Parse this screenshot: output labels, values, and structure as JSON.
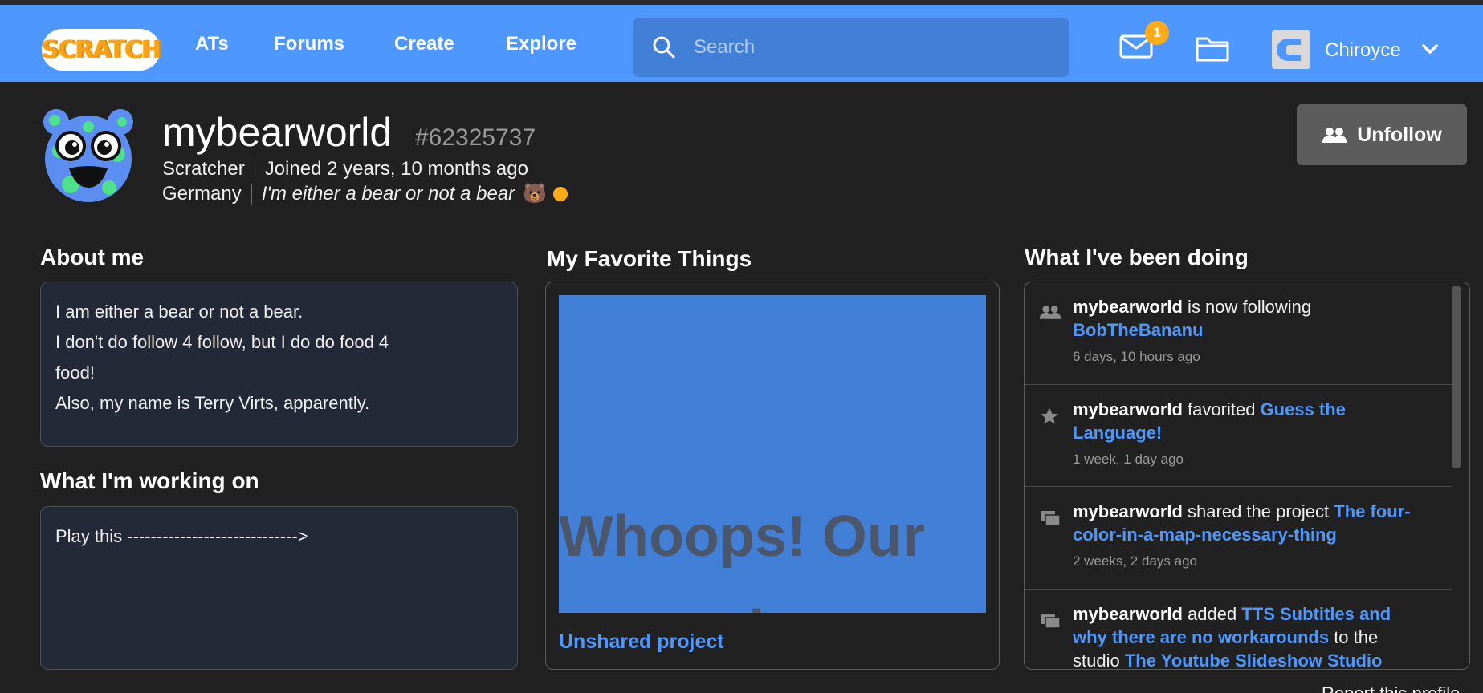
{
  "nav": {
    "logo": "SCRATCH",
    "links": [
      "ATs",
      "Forums",
      "Create",
      "Explore"
    ],
    "search_placeholder": "Search",
    "message_count": "1",
    "username": "Chiroyce"
  },
  "profile": {
    "name": "mybearworld",
    "id": "#62325737",
    "role": "Scratcher",
    "joined": "Joined 2 years, 10 months ago",
    "country": "Germany",
    "status": "I'm either a bear or not a bear",
    "status_emoji": "🐻",
    "unfollow_label": "Unfollow"
  },
  "about": {
    "title": "About me",
    "lines": [
      "I am either a bear or not a bear.",
      "I don't do follow 4 follow, but I do do food 4",
      "food!",
      "Also, my name is Terry Virts, apparently."
    ]
  },
  "working": {
    "title": "What I'm working on",
    "text": "Play this ----------------------------->"
  },
  "favorite": {
    "title": "My Favorite Things",
    "thumb_text": "Whoops! Our server is",
    "project_title": "Unshared project"
  },
  "activity": {
    "title": "What I've been doing",
    "items": [
      {
        "icon": "follow-icon",
        "actor": "mybearworld",
        "verb": " is now following ",
        "link1": "BobTheBananu",
        "mid": "",
        "link2": "",
        "time": "6 days, 10 hours ago"
      },
      {
        "icon": "star-icon",
        "actor": "mybearworld",
        "verb": " favorited ",
        "link1": "Guess the Language!",
        "mid": "",
        "link2": "",
        "time": "1 week, 1 day ago"
      },
      {
        "icon": "share-icon",
        "actor": "mybearworld",
        "verb": " shared the project ",
        "link1": "The four-color-in-a-map-necessary-thing",
        "mid": "",
        "link2": "",
        "time": "2 weeks, 2 days ago"
      },
      {
        "icon": "studio-icon",
        "actor": "mybearworld",
        "verb": " added ",
        "link1": "TTS Subtitles and why there are no workarounds",
        "mid": " to the studio ",
        "link2": "The Youtube Slideshow Studio",
        "time": ""
      }
    ]
  },
  "footer": {
    "report_label": "Report this profile"
  },
  "colors": {
    "navbar": "#4d97ff",
    "background": "#212121",
    "link": "#4d97ff",
    "badge": "#ffab1a"
  }
}
